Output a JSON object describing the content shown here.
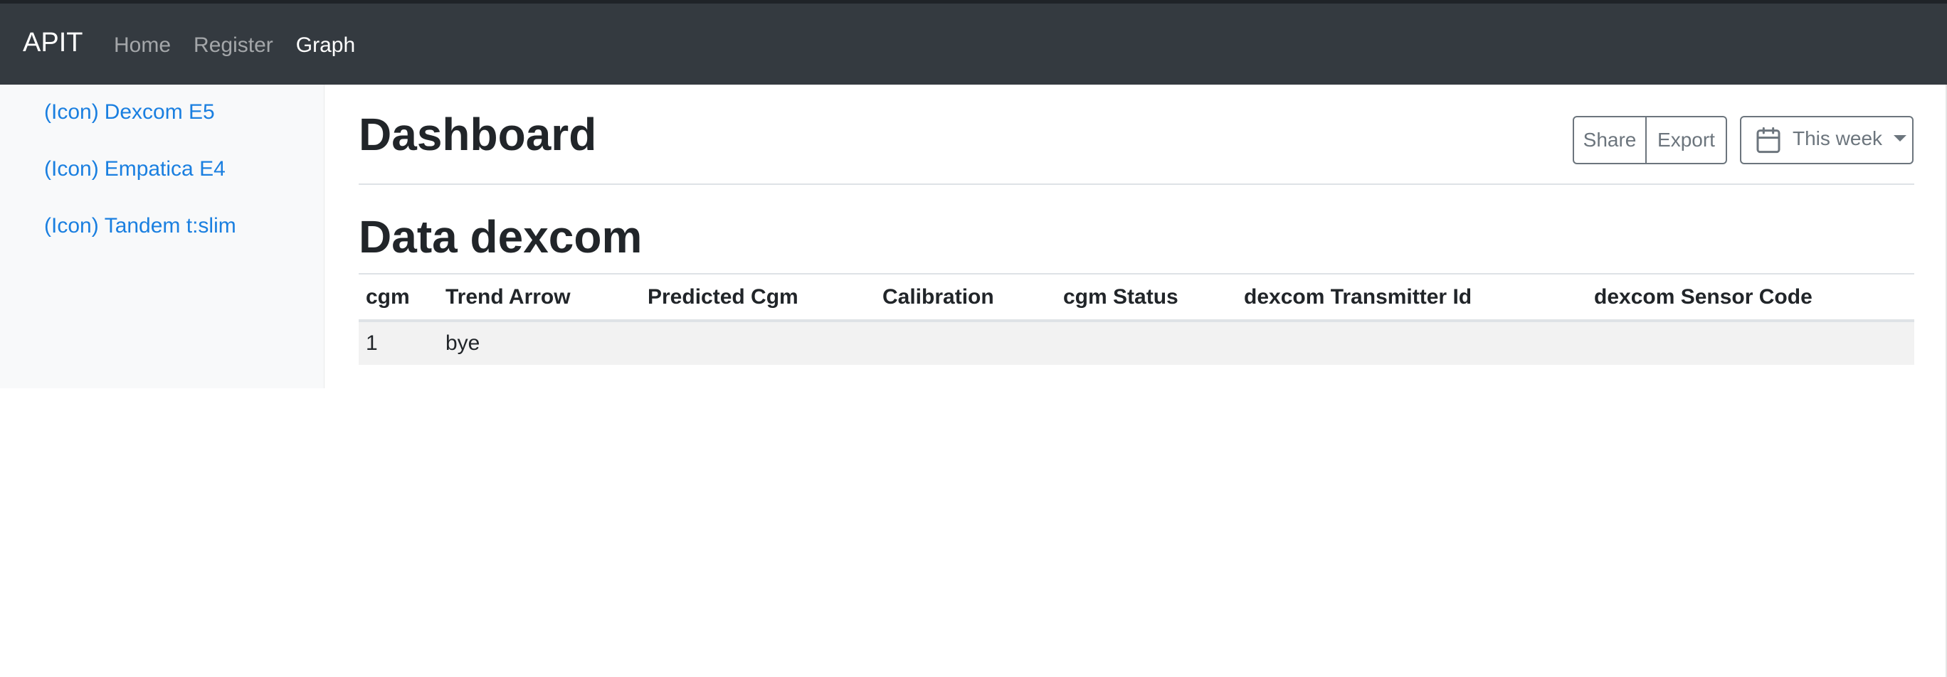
{
  "navbar": {
    "brand": "APIT",
    "links": [
      {
        "label": "Home",
        "active": false
      },
      {
        "label": "Register",
        "active": false
      },
      {
        "label": "Graph",
        "active": true
      }
    ]
  },
  "sidebar": {
    "items": [
      {
        "icon_text": "(Icon)",
        "label": "Dexcom E5"
      },
      {
        "icon_text": "(Icon)",
        "label": "Empatica E4"
      },
      {
        "icon_text": "(Icon)",
        "label": "Tandem t:slim"
      }
    ]
  },
  "main": {
    "title": "Dashboard",
    "toolbar": {
      "share_label": "Share",
      "export_label": "Export",
      "range_label": "This week",
      "range_icon": "calendar-icon"
    },
    "section_title": "Data dexcom",
    "table": {
      "headers": [
        "cgm",
        "Trend Arrow",
        "Predicted Cgm",
        "Calibration",
        "cgm Status",
        "dexcom Transmitter Id",
        "dexcom Sensor Code"
      ],
      "rows": [
        [
          "1",
          "bye",
          "",
          "",
          "",
          "",
          ""
        ]
      ]
    }
  },
  "colors": {
    "navbar_bg": "#343a40",
    "sidebar_bg": "#f8f9fa",
    "link_blue": "#1a7fe0",
    "row_stripe": "#f2f2f2"
  }
}
